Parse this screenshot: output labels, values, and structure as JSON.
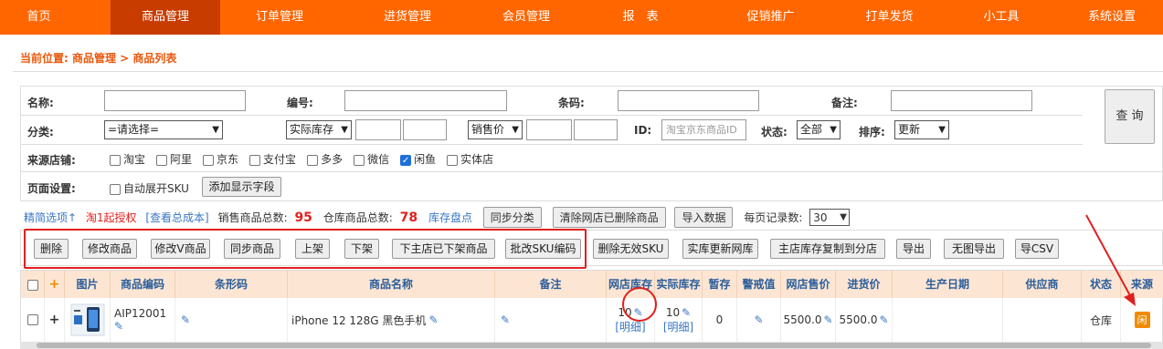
{
  "nav": {
    "items": [
      "首页",
      "商品管理",
      "订单管理",
      "进货管理",
      "会员管理",
      "报　表",
      "促销推广",
      "打单发货",
      "小工具",
      "系统设置"
    ],
    "active": "商品管理"
  },
  "breadcrumb": "当前位置: 商品管理 > 商品列表",
  "filter": {
    "name_label": "名称:",
    "code_label": "编号:",
    "barcode_label": "条码:",
    "remark_label": "备注:",
    "query_button": "查 询",
    "category_label": "分类:",
    "category_value": "=请选择=",
    "stock_select": "实际库存",
    "price_select": "销售价",
    "id_label": "ID:",
    "id_placeholder": "淘宝京东商品ID",
    "status_label": "状态:",
    "status_value": "全部",
    "sort_label": "排序:",
    "sort_value": "更新",
    "source_label": "来源店铺:",
    "sources": [
      {
        "label": "淘宝",
        "checked": false
      },
      {
        "label": "阿里",
        "checked": false
      },
      {
        "label": "京东",
        "checked": false
      },
      {
        "label": "支付宝",
        "checked": false
      },
      {
        "label": "多多",
        "checked": false
      },
      {
        "label": "微信",
        "checked": false
      },
      {
        "label": "闲鱼",
        "checked": true
      },
      {
        "label": "实体店",
        "checked": false
      }
    ],
    "page_settings_label": "页面设置:",
    "auto_expand_sku": "自动展开SKU",
    "add_field_button": "添加显示字段"
  },
  "info": {
    "simple_options": "精简选项↑",
    "taobao_auth": "淘1起授权",
    "view_cost": "[查看总成本]",
    "sales_total_label": "销售商品总数:",
    "sales_total": "95",
    "warehouse_total_label": "仓库商品总数:",
    "warehouse_total": "78",
    "inventory_check": "库存盘点",
    "sync_category_button": "同步分类",
    "clear_deleted_button": "清除网店已删除商品",
    "import_button": "导入数据",
    "per_page_label": "每页记录数:",
    "per_page_value": "30"
  },
  "actions": [
    "删除",
    "修改商品",
    "修改V商品",
    "同步商品",
    "上架",
    "下架",
    "下主店已下架商品",
    "批改SKU编码",
    "删除无效SKU",
    "实库更新网库",
    "主店库存复制到分店",
    "导出",
    "无图导出",
    "导CSV"
  ],
  "table": {
    "headers": [
      "",
      "+",
      "图片",
      "商品编码",
      "条形码",
      "商品名称",
      "备注",
      "网店库存",
      "实际库存",
      "暂存",
      "警戒值",
      "网店售价",
      "进货价",
      "生产日期",
      "供应商",
      "状态",
      "来源"
    ],
    "rows": [
      {
        "expand": "+",
        "code": "AIP12001",
        "name": "iPhone 12 128G 黑色手机",
        "online_stock": "10",
        "online_stock_detail": "[明细]",
        "actual_stock": "10",
        "actual_stock_detail": "[明细]",
        "temp": "0",
        "price": "5500.0",
        "cost": "5500.0",
        "status": "仓库",
        "source_badge": "闲"
      }
    ]
  },
  "colors": {
    "nav_bg": "#ff6600",
    "nav_active": "#c83c00",
    "header_bg": "#fce6d3",
    "annotation_red": "#e0201e",
    "source_badge": "#f08a00"
  }
}
